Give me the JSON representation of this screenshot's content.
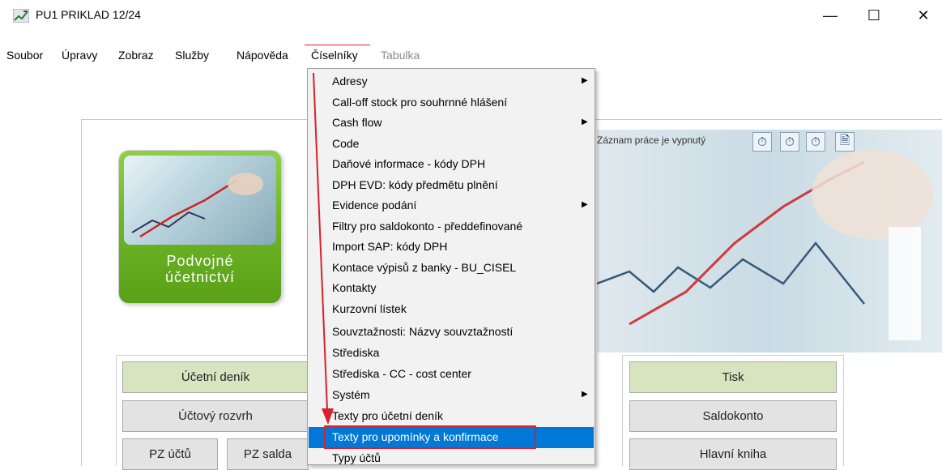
{
  "window": {
    "title": "PU1 PRIKLAD 12/24",
    "minimize_glyph": "—",
    "maximize_glyph": "☐",
    "close_glyph": "✕"
  },
  "menubar": [
    "Soubor",
    "Úpravy",
    "Zobraz",
    "Služby",
    "Nápověda",
    "Číselníky",
    "Tabulka"
  ],
  "tile": {
    "line1": "Podvojné",
    "line2": "účetnictví"
  },
  "toolbar": {
    "record_status": "Záznam práce je vypnutý"
  },
  "buttons_left": [
    "Účetní deník",
    "Účtový rozvrh",
    "PZ účtů",
    "PZ salda"
  ],
  "buttons_right": [
    "Tisk",
    "Saldokonto",
    "Hlavní kniha"
  ],
  "dropdown": {
    "items": [
      {
        "label": "Adresy",
        "submenu": true
      },
      {
        "label": "Call-off stock pro souhrnné hlášení",
        "submenu": false
      },
      {
        "label": "Cash flow",
        "submenu": true
      },
      {
        "label": "Code",
        "submenu": false
      },
      {
        "label": "Daňové informace - kódy DPH",
        "submenu": false
      },
      {
        "label": "DPH EVD: kódy předmětu plnění",
        "submenu": false
      },
      {
        "label": "Evidence podání",
        "submenu": true
      },
      {
        "label": "Filtry pro saldokonto - předdefinované",
        "submenu": false
      },
      {
        "label": "Import SAP: kódy DPH",
        "submenu": false
      },
      {
        "label": "Kontace výpisů z banky - BU_CISEL",
        "submenu": false
      },
      {
        "label": "Kontakty",
        "submenu": false
      },
      {
        "label": "Kurzovní lístek",
        "submenu": false
      },
      {
        "label": "Souvztažnosti: Názvy souvztažností",
        "submenu": false
      },
      {
        "label": "Střediska",
        "submenu": false
      },
      {
        "label": "Střediska - CC - cost center",
        "submenu": false
      },
      {
        "label": "Systém",
        "submenu": true
      },
      {
        "label": "Texty pro účetní deník",
        "submenu": false
      },
      {
        "label": "Texty pro upomínky a konfirmace",
        "submenu": false
      },
      {
        "label": "Typy účtů",
        "submenu": false
      }
    ],
    "selected_index": 17
  },
  "colors": {
    "highlight": "#0078d7",
    "annotation_red": "#d9212b"
  }
}
